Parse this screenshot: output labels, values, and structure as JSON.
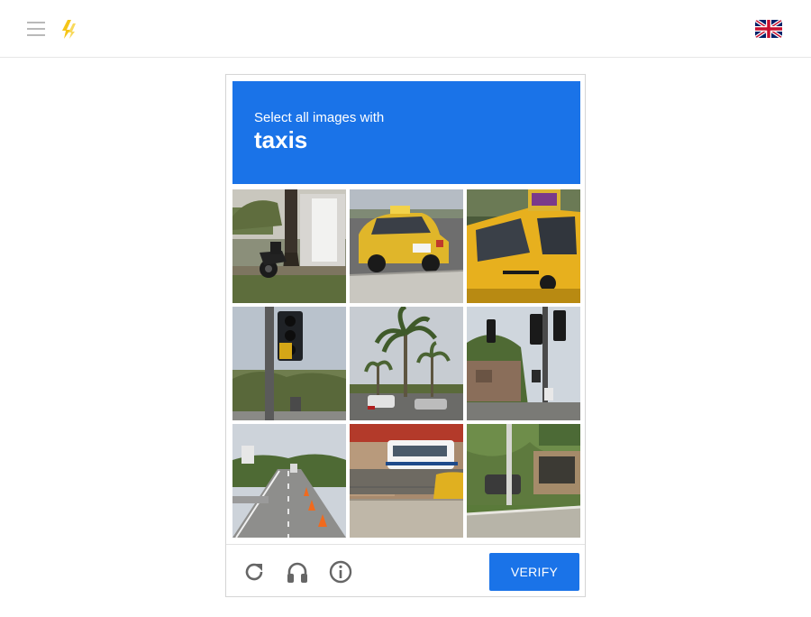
{
  "topbar": {
    "menu_icon": "hamburger-menu-icon",
    "logo_icon": "lightning-logo-icon",
    "language_icon": "uk-flag-icon"
  },
  "challenge": {
    "instruction": "Select all images with",
    "target": "taxis",
    "accent_color": "#1a73e8",
    "tiles": [
      {
        "scene": "motorcycle under tree"
      },
      {
        "scene": "yellow taxi on road"
      },
      {
        "scene": "yellow taxi close-up"
      },
      {
        "scene": "traffic light"
      },
      {
        "scene": "palm trees"
      },
      {
        "scene": "traffic lights at intersection"
      },
      {
        "scene": "highway with cones"
      },
      {
        "scene": "bus and taxi behind wall"
      },
      {
        "scene": "pole and trees"
      }
    ]
  },
  "footer": {
    "reload_icon": "reload-icon",
    "audio_icon": "headphones-icon",
    "info_icon": "info-icon",
    "verify_label": "VERIFY"
  }
}
